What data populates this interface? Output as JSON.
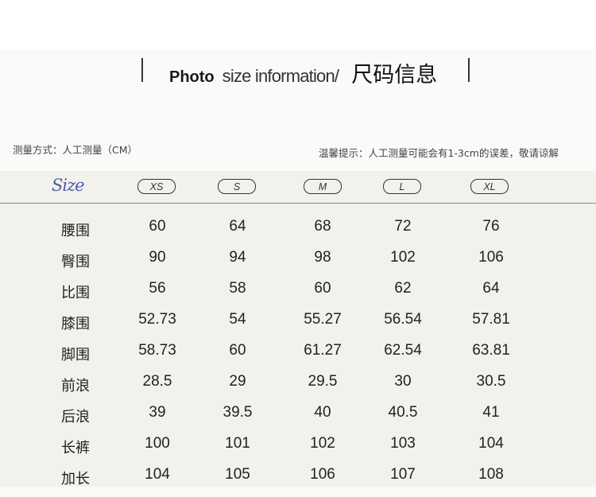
{
  "header": {
    "photo": "Photo",
    "size_info": "size information/",
    "cn_title": "尺码信息"
  },
  "notes": {
    "method": "测量方式：人工测量（CM）",
    "tip": "温馨提示：人工测量可能会有1-3cm的误差，敬请谅解"
  },
  "table": {
    "size_label": "Size",
    "sizes": [
      "XS",
      "S",
      "M",
      "L",
      "XL"
    ],
    "rows": [
      {
        "name": "腰围",
        "values": [
          "60",
          "64",
          "68",
          "72",
          "76"
        ]
      },
      {
        "name": "臀围",
        "values": [
          "90",
          "94",
          "98",
          "102",
          "106"
        ]
      },
      {
        "name": "比围",
        "values": [
          "56",
          "58",
          "60",
          "62",
          "64"
        ]
      },
      {
        "name": "膝围",
        "values": [
          "52.73",
          "54",
          "55.27",
          "56.54",
          "57.81"
        ]
      },
      {
        "name": "脚围",
        "values": [
          "58.73",
          "60",
          "61.27",
          "62.54",
          "63.81"
        ]
      },
      {
        "name": "前浪",
        "values": [
          "28.5",
          "29",
          "29.5",
          "30",
          "30.5"
        ]
      },
      {
        "name": "后浪",
        "values": [
          "39",
          "39.5",
          "40",
          "40.5",
          "41"
        ]
      },
      {
        "name": "长裤",
        "values": [
          "100",
          "101",
          "102",
          "103",
          "104"
        ]
      },
      {
        "name": "加长",
        "values": [
          "104",
          "105",
          "106",
          "107",
          "108"
        ]
      }
    ]
  }
}
